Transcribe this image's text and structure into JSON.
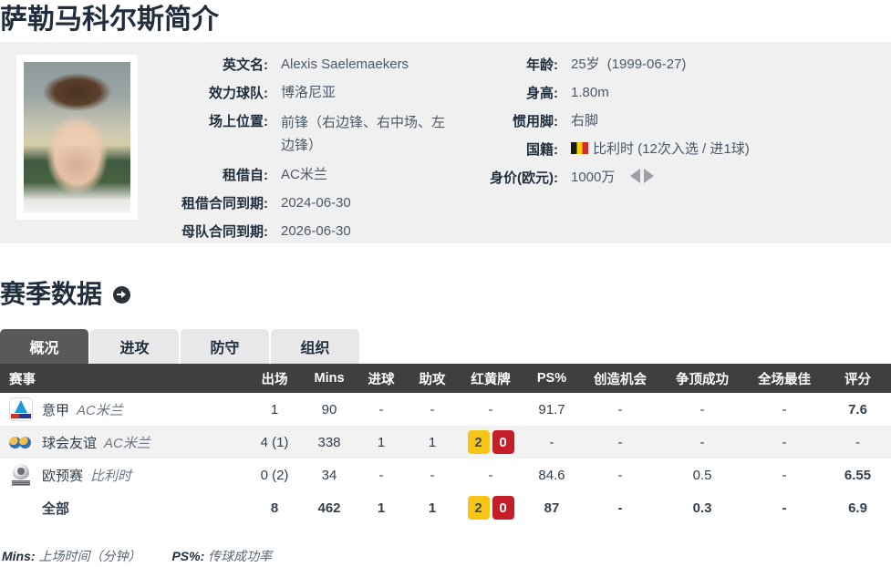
{
  "page_title": "萨勒马科尔斯简介",
  "info": {
    "left": [
      {
        "label": "英文名:",
        "value": "Alexis Saelemaekers"
      },
      {
        "label": "效力球队:",
        "value": "博洛尼亚"
      },
      {
        "label": "场上位置:",
        "value": "前锋（右边锋、右中场、左边锋）"
      },
      {
        "label": "租借自:",
        "value": "AC米兰"
      },
      {
        "label": "租借合同到期:",
        "value": "2024-06-30"
      },
      {
        "label": "母队合同到期:",
        "value": "2026-06-30"
      }
    ],
    "right": {
      "age_label": "年龄:",
      "age_value": "25岁",
      "birth_date": "(1999-06-27)",
      "height_label": "身高:",
      "height_value": "1.80m",
      "foot_label": "惯用脚:",
      "foot_value": "右脚",
      "nationality_label": "国籍:",
      "nationality_value": "比利时 (12次入选 / 进1球)",
      "nationality_flag": "belgium-flag-icon",
      "value_label": "身价(欧元):",
      "value_value": "1000万",
      "value_trend_icon": "double-arrow-icon"
    }
  },
  "season": {
    "title": "赛季数据",
    "arrow_icon": "arrow-right-circle-icon",
    "tabs": [
      {
        "label": "概况",
        "active": true
      },
      {
        "label": "进攻",
        "active": false
      },
      {
        "label": "防守",
        "active": false
      },
      {
        "label": "组织",
        "active": false
      }
    ],
    "columns": [
      "赛事",
      "出场",
      "Mins",
      "进球",
      "助攻",
      "红黄牌",
      "PS%",
      "创造机会",
      "争顶成功",
      "全场最佳",
      "评分"
    ],
    "rows": [
      {
        "logo": "serie-a-logo",
        "competition": "意甲",
        "team": "AC米兰",
        "apps": "1",
        "mins": "90",
        "goals": "-",
        "assists": "-",
        "cards": null,
        "cards_text": "-",
        "ps": "91.7",
        "chances": "-",
        "aerials": "-",
        "motm": "-",
        "rating": "7.6"
      },
      {
        "logo": "club-friendly-logo",
        "competition": "球会友谊",
        "team": "AC米兰",
        "apps": "4 (1)",
        "mins": "338",
        "goals": "1",
        "assists": "1",
        "cards": {
          "yellow": "2",
          "red": "0"
        },
        "cards_text": "",
        "ps": "-",
        "chances": "-",
        "aerials": "-",
        "motm": "-",
        "rating": "-"
      },
      {
        "logo": "euro-qualifiers-logo",
        "competition": "欧预赛",
        "team": "比利时",
        "apps": "0 (2)",
        "mins": "34",
        "goals": "-",
        "assists": "-",
        "cards": null,
        "cards_text": "-",
        "ps": "84.6",
        "chances": "-",
        "aerials": "0.5",
        "motm": "-",
        "rating": "6.55"
      },
      {
        "logo": null,
        "competition": "全部",
        "team": "",
        "apps": "8",
        "mins": "462",
        "goals": "1",
        "assists": "1",
        "cards": {
          "yellow": "2",
          "red": "0"
        },
        "cards_text": "",
        "ps": "87",
        "chances": "-",
        "aerials": "0.3",
        "motm": "-",
        "rating": "6.9",
        "total": true
      }
    ],
    "footnotes": [
      {
        "key": "Mins:",
        "text": "上场时间（分钟）"
      },
      {
        "key": "PS%:",
        "text": "传球成功率"
      }
    ]
  },
  "colors": {
    "rating": "#eb4b0a",
    "header_bg": "#3f3f3f",
    "tab_active_bg": "#595959",
    "panel_bg": "#f0f0f0",
    "yellow_card": "#f5c518",
    "red_card": "#c41e28"
  }
}
